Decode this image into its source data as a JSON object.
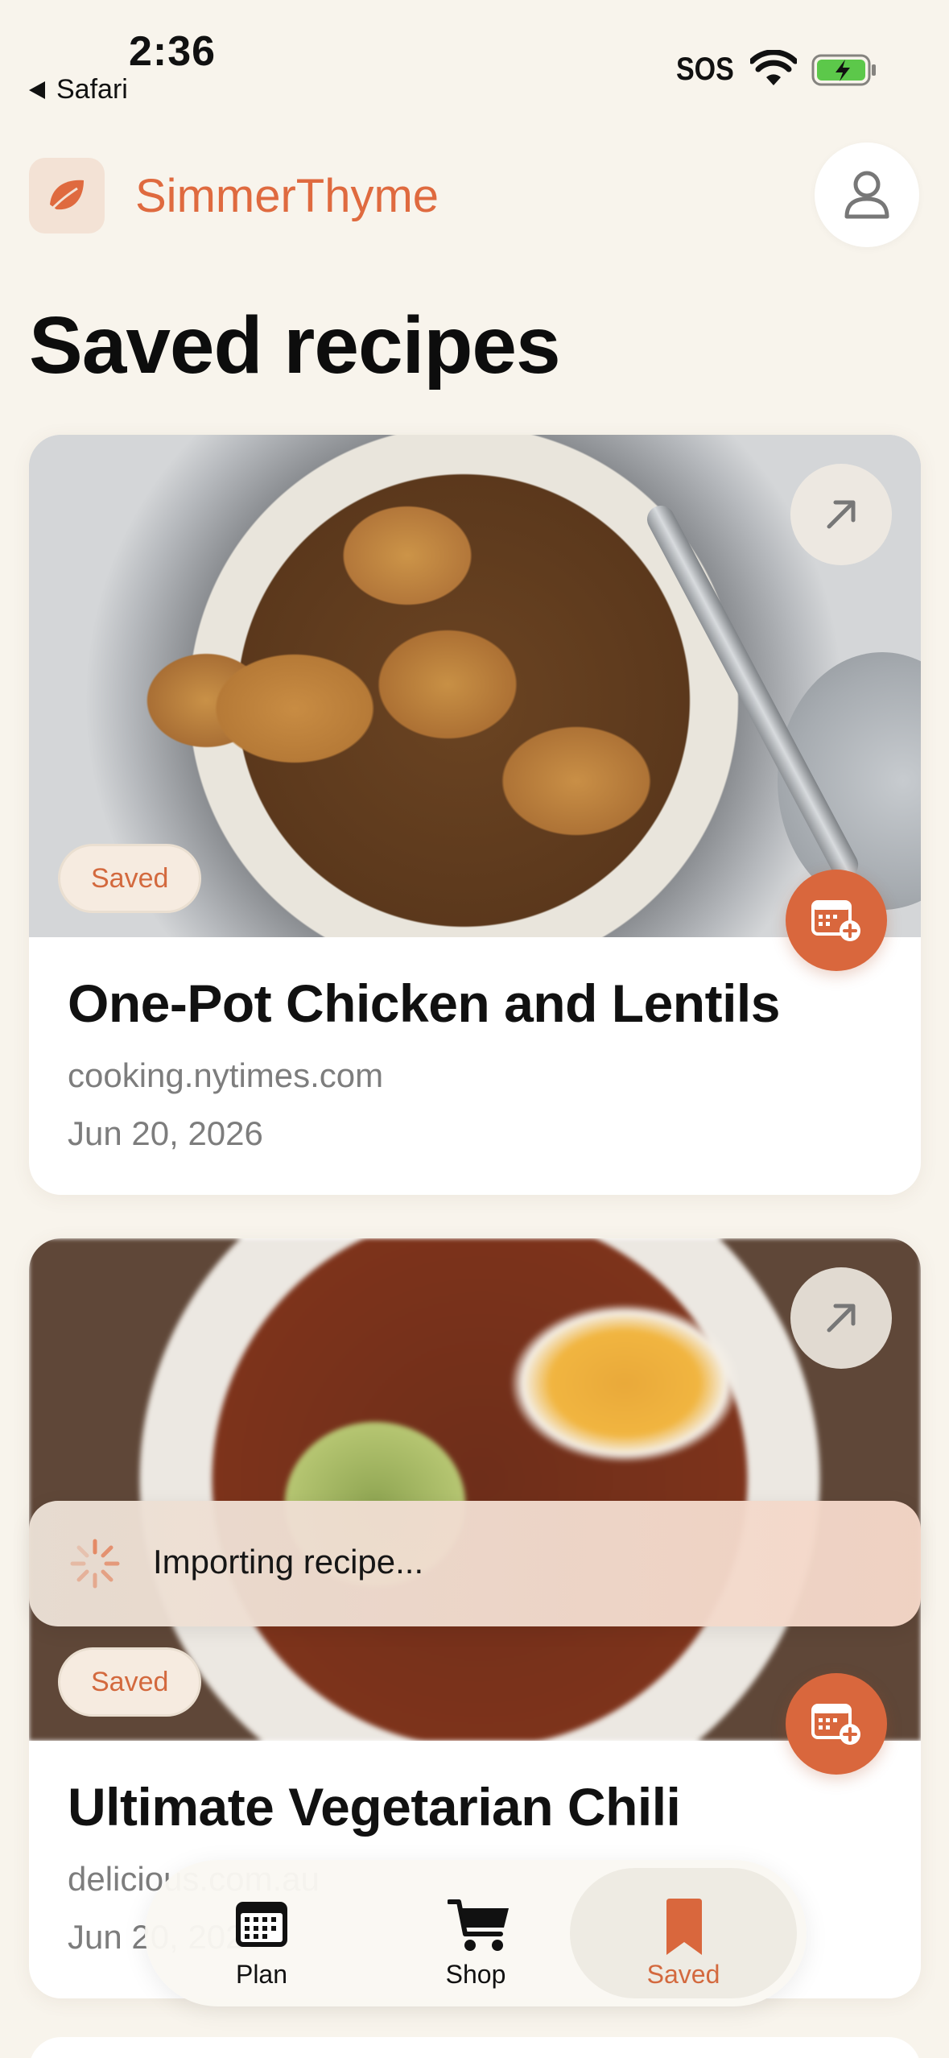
{
  "status_bar": {
    "time": "2:36",
    "back_label": "Safari",
    "carrier": "SOS"
  },
  "header": {
    "app_name": "SimmerThyme"
  },
  "page": {
    "title": "Saved recipes"
  },
  "recipes": [
    {
      "title": "One-Pot Chicken and Lentils",
      "source": "cooking.nytimes.com",
      "date": "Jun 20, 2026",
      "badge": "Saved"
    },
    {
      "title": "Ultimate Vegetarian Chili",
      "source": "delicious.com.au",
      "date": "Jun 20, 2026",
      "badge": "Saved"
    }
  ],
  "toast": {
    "message": "Importing recipe..."
  },
  "tabbar": {
    "tabs": [
      {
        "label": "Plan",
        "icon": "calendar-icon"
      },
      {
        "label": "Shop",
        "icon": "cart-icon"
      },
      {
        "label": "Saved",
        "icon": "bookmark-icon",
        "active": true
      }
    ]
  },
  "colors": {
    "accent": "#d9673d",
    "background": "#f8f4ec",
    "pill_bg": "#f6ebe0"
  }
}
